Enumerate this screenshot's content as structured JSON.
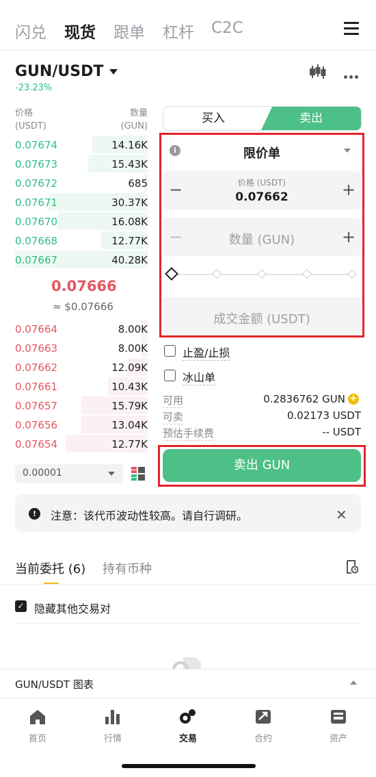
{
  "top_tabs": [
    "闪兑",
    "现货",
    "跟单",
    "杠杆",
    "C2C"
  ],
  "pair": {
    "name": "GUN/USDT",
    "change": "-23.23%"
  },
  "orderbook": {
    "price_header": [
      "价格",
      "(USDT)"
    ],
    "qty_header": [
      "数量",
      "(GUN)"
    ],
    "asks": [
      {
        "price": "0.07674",
        "qty": "14.16K",
        "depth": 0.42
      },
      {
        "price": "0.07673",
        "qty": "15.43K",
        "depth": 0.45
      },
      {
        "price": "0.07672",
        "qty": "685",
        "depth": 0.03
      },
      {
        "price": "0.07671",
        "qty": "30.37K",
        "depth": 0.75
      },
      {
        "price": "0.07670",
        "qty": "16.08K",
        "depth": 0.68
      },
      {
        "price": "0.07668",
        "qty": "12.77K",
        "depth": 0.35
      },
      {
        "price": "0.07667",
        "qty": "40.28K",
        "depth": 1.0
      }
    ],
    "mid_price": "0.07666",
    "mid_fiat": "≈ $0.07666",
    "bids": [
      {
        "price": "0.07664",
        "qty": "8.00K",
        "depth": 0.05
      },
      {
        "price": "0.07663",
        "qty": "8.00K",
        "depth": 0.05
      },
      {
        "price": "0.07662",
        "qty": "12.09K",
        "depth": 0.15
      },
      {
        "price": "0.07661",
        "qty": "10.43K",
        "depth": 0.3
      },
      {
        "price": "0.07657",
        "qty": "15.79K",
        "depth": 0.5
      },
      {
        "price": "0.07656",
        "qty": "13.04K",
        "depth": 0.5
      },
      {
        "price": "0.07654",
        "qty": "12.77K",
        "depth": 0.62
      }
    ],
    "precision": "0.00001"
  },
  "toggle": {
    "buy": "买入",
    "sell": "卖出"
  },
  "form": {
    "order_type": "限价单",
    "price_label": "价格 (USDT)",
    "price_value": "0.07662",
    "qty_placeholder": "数量 (GUN)",
    "total_placeholder": "成交金额 (USDT)",
    "tp_sl": "止盈/止损",
    "iceberg": "冰山单",
    "available_label": "可用",
    "available_value": "0.2836762 GUN",
    "sellable_label": "可卖",
    "sellable_value": "0.02173 USDT",
    "fee_label": "预估手续费",
    "fee_value": "-- USDT",
    "submit": "卖出 GUN",
    "slider_percent": 0
  },
  "notice": "注意：该代币波动性较高。请自行调研。",
  "orders": {
    "tab_open": "当前委托 (6)",
    "tab_holdings": "持有币种",
    "hide_other": "隐藏其他交易对"
  },
  "chart_bar": "GUN/USDT 图表",
  "nav": [
    "首页",
    "行情",
    "交易",
    "合约",
    "资产"
  ],
  "colors": {
    "green": "#4dc087",
    "red": "#e45660",
    "highlight": "#e3242b",
    "accent": "#f0b90b"
  }
}
